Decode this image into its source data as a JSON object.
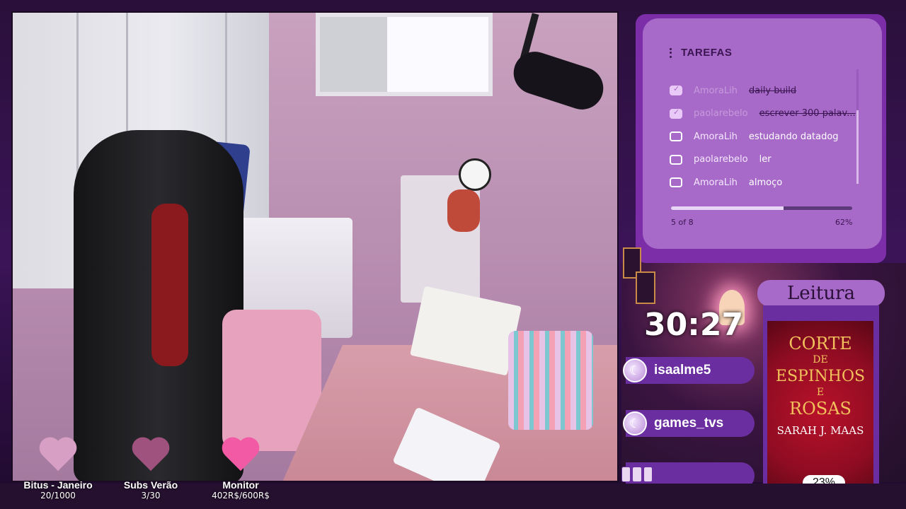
{
  "tasks": {
    "title": "TAREFAS",
    "items": [
      {
        "user": "AmoraLih",
        "text": "daily build",
        "done": true
      },
      {
        "user": "paolarebelo",
        "text": "escrever 300 palav...",
        "done": true
      },
      {
        "user": "AmoraLih",
        "text": "estudando datadog",
        "done": false
      },
      {
        "user": "paolarebelo",
        "text": "ler",
        "done": false
      },
      {
        "user": "AmoraLih",
        "text": "almoço",
        "done": false
      }
    ],
    "progress_count": "5 of 8",
    "progress_percent": "62%",
    "progress_fraction": 0.62
  },
  "timer": "30:27",
  "chat_alerts": [
    {
      "name": "isaalme5",
      "icon": "moon"
    },
    {
      "name": "games_tvs",
      "icon": "moon"
    },
    {
      "name": "",
      "icon": ""
    }
  ],
  "book": {
    "tab_label": "Leitura",
    "title_line1": "CORTE",
    "title_line2": "DE",
    "title_line3": "ESPINHOS",
    "title_line4": "E",
    "title_line5": "ROSAS",
    "author": "SARAH J. MAAS",
    "progress": "23%"
  },
  "goals": [
    {
      "label": "Bitus - Janeiro",
      "value": "20/1000",
      "color": "#d79fc3"
    },
    {
      "label": "Subs Verão",
      "value": "3/30",
      "color": "#a0527e"
    },
    {
      "label": "Monitor",
      "value": "402R$/600R$",
      "color": "#f25aa6"
    }
  ]
}
